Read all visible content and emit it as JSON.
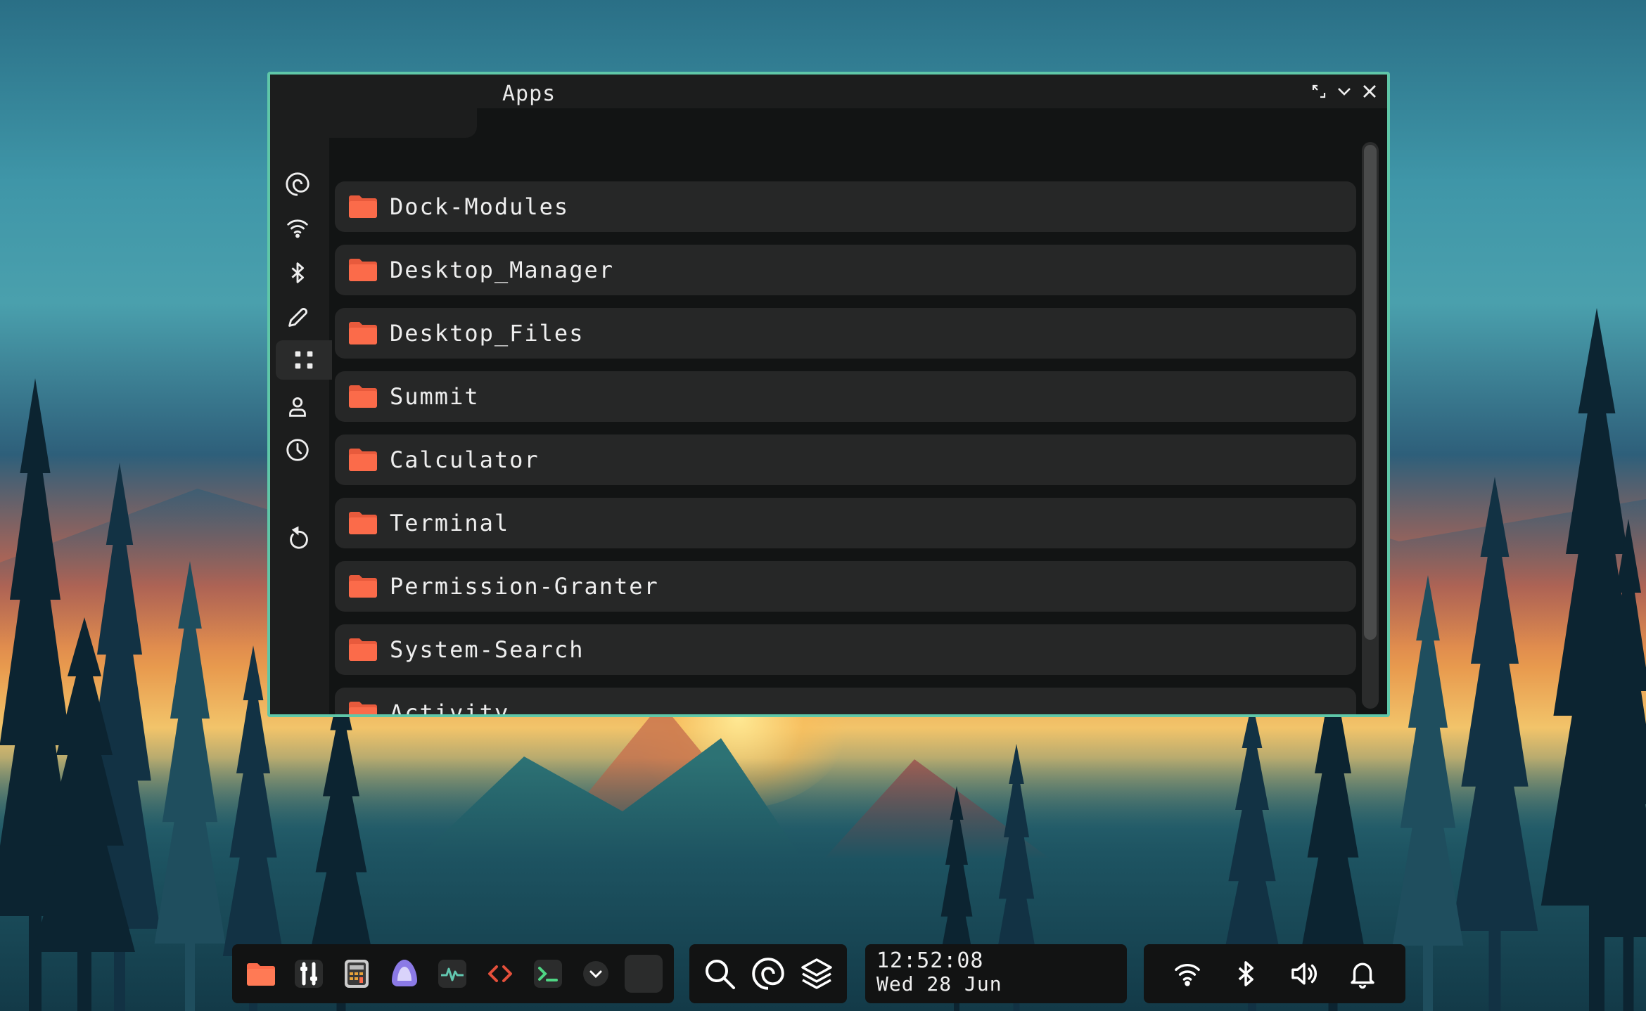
{
  "window": {
    "title": "Apps",
    "controls": [
      "resize-icon",
      "minimize-chevron-icon",
      "close-icon"
    ]
  },
  "sidebar": {
    "items": [
      {
        "name": "overview",
        "icon": "spiral-icon"
      },
      {
        "name": "wifi",
        "icon": "wifi-icon"
      },
      {
        "name": "bluetooth",
        "icon": "bluetooth-icon"
      },
      {
        "name": "customize",
        "icon": "pencil-icon"
      },
      {
        "name": "apps",
        "icon": "apps-grid-icon",
        "active": true
      },
      {
        "name": "user",
        "icon": "user-icon"
      },
      {
        "name": "time",
        "icon": "clock-icon"
      },
      {
        "name": "reset",
        "icon": "restart-icon"
      }
    ]
  },
  "apps": {
    "items": [
      {
        "label": "Dock-Modules"
      },
      {
        "label": "Desktop_Manager"
      },
      {
        "label": "Desktop_Files"
      },
      {
        "label": "Summit"
      },
      {
        "label": "Calculator"
      },
      {
        "label": "Terminal"
      },
      {
        "label": "Permission-Granter"
      },
      {
        "label": "System-Search"
      },
      {
        "label": "Activity"
      }
    ]
  },
  "taskbar": {
    "dock": [
      "folder-icon",
      "sliders-icon",
      "calculator-icon",
      "summit-icon",
      "activity-icon",
      "code-icon",
      "terminal-icon",
      "chevron-down-icon",
      "empty-slot"
    ],
    "middle": [
      "search-icon",
      "spiral-icon",
      "layers-icon"
    ],
    "clock": {
      "time": "12:52:08",
      "date": "Wed 28 Jun"
    },
    "tray": [
      "wifi-icon",
      "bluetooth-icon",
      "volume-icon",
      "bell-icon"
    ]
  },
  "colors": {
    "accent_border": "#5fc7a8",
    "folder": "#fb6b4a",
    "window_bg": "#1c1d1d",
    "row_bg": "#262727"
  }
}
